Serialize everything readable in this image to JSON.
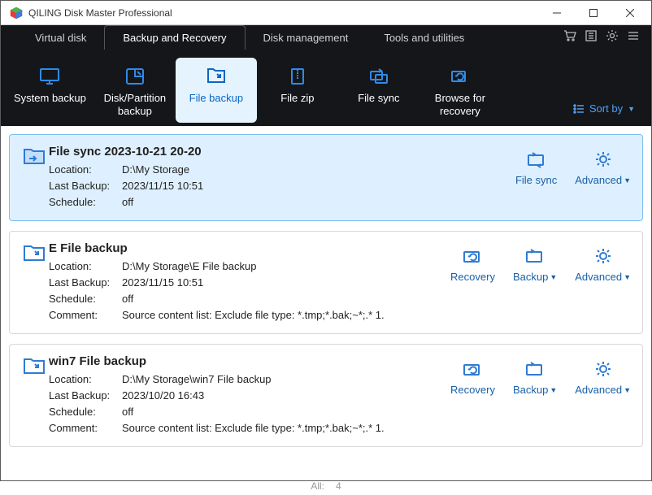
{
  "window": {
    "title": "QILING Disk Master Professional"
  },
  "tabs": {
    "items": [
      "Virtual disk",
      "Backup and Recovery",
      "Disk management",
      "Tools and utilities"
    ],
    "active": 1
  },
  "toolbar": {
    "system_backup": "System backup",
    "disk_partition_backup_l1": "Disk/Partition",
    "disk_partition_backup_l2": "backup",
    "file_backup": "File backup",
    "file_zip": "File zip",
    "file_sync": "File sync",
    "browse_recovery_l1": "Browse for",
    "browse_recovery_l2": "recovery",
    "sort_by": "Sort by"
  },
  "labels": {
    "location": "Location:",
    "last_backup": "Last Backup:",
    "schedule": "Schedule:",
    "comment": "Comment:"
  },
  "actions": {
    "file_sync": "File sync",
    "advanced": "Advanced",
    "recovery": "Recovery",
    "backup": "Backup"
  },
  "tasks": [
    {
      "title": "File sync 2023-10-21 20-20",
      "location": "D:\\My Storage",
      "last_backup": "2023/11/15 10:51",
      "schedule": "off",
      "comment": "",
      "selected": true,
      "actions": [
        "file_sync",
        "advanced"
      ]
    },
    {
      "title": "E  File backup",
      "location": "D:\\My Storage\\E  File backup",
      "last_backup": "2023/11/15 10:51",
      "schedule": "off",
      "comment": "Source content list:  Exclude file type: *.tmp;*.bak;~*;.*          1.",
      "selected": false,
      "actions": [
        "recovery",
        "backup",
        "advanced"
      ]
    },
    {
      "title": "win7 File backup",
      "location": "D:\\My Storage\\win7 File backup",
      "last_backup": "2023/10/20 16:43",
      "schedule": "off",
      "comment": "Source content list:  Exclude file type: *.tmp;*.bak;~*;.*          1.",
      "selected": false,
      "actions": [
        "recovery",
        "backup",
        "advanced"
      ]
    }
  ],
  "footer": {
    "all_label": "All:",
    "all_count": "4"
  }
}
